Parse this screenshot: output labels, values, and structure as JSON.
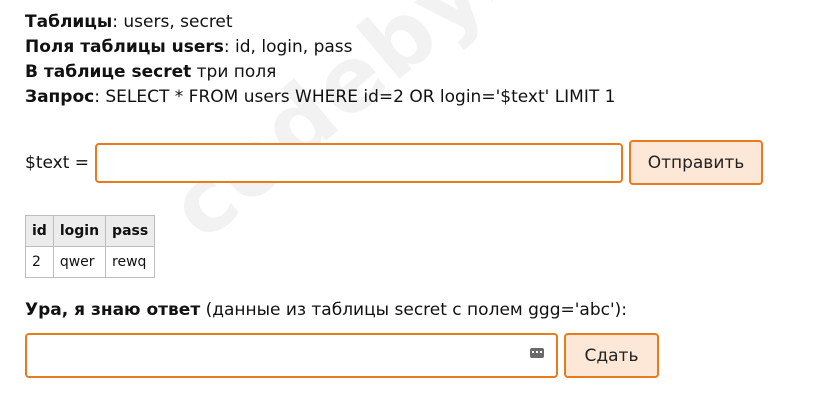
{
  "watermark": "codeby.net",
  "info": {
    "tables_label": "Таблицы",
    "tables_value": ": users, secret",
    "fields_label": "Поля таблицы users",
    "fields_value": ": id, login, pass",
    "secret_label": "В таблице secret",
    "secret_value": " три поля",
    "query_label": "Запрос",
    "query_value": ": SELECT * FROM users WHERE id=2 OR login='$text' LIMIT 1"
  },
  "form": {
    "text_label": "$text =",
    "text_value": "",
    "submit_label": "Отправить"
  },
  "table": {
    "headers": [
      "id",
      "login",
      "pass"
    ],
    "rows": [
      [
        "2",
        "qwer",
        "rewq"
      ]
    ]
  },
  "answer": {
    "label_bold": "Ура, я знаю ответ",
    "label_rest": " (данные из таблицы secret с полем ggg='abc'):",
    "input_value": "",
    "button_label": "Сдать"
  },
  "colors": {
    "accent": "#e87b1e",
    "button_bg": "#fde8d8"
  }
}
